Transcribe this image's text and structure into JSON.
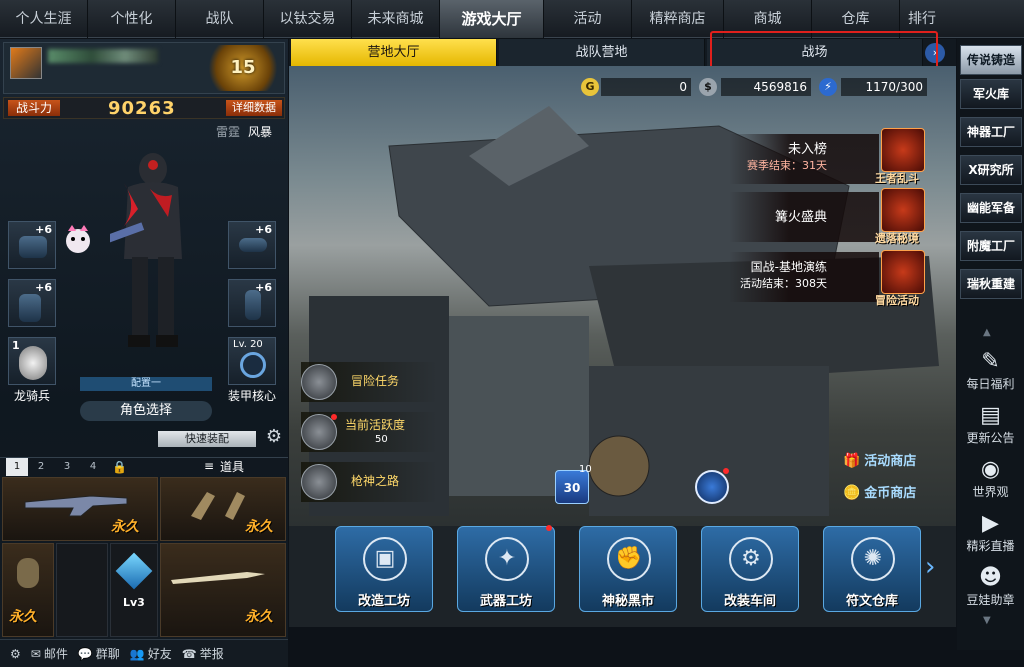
{
  "top_nav": [
    "个人生涯",
    "个性化",
    "战队",
    "以钛交易",
    "未来商城",
    "游戏大厅",
    "活动",
    "精粹商店",
    "商城",
    "仓库",
    "排行"
  ],
  "top_nav_active": 5,
  "profile": {
    "rank_level": "15",
    "combat_power_label": "战斗力",
    "combat_power_value": "90263",
    "detail_label": "详细数据",
    "mode_a": "雷霆",
    "mode_b": "风暴",
    "equip_plus_1": "+6",
    "equip_plus_2": "+6",
    "equip_plus_3": "+6",
    "equip_plus_4": "+6",
    "mount_level": "1",
    "mount_name": "龙骑兵",
    "core_level": "Lv. 20",
    "core_name": "装甲核心",
    "config_label": "配置一",
    "role_select_label": "角色选择",
    "quick_equip_label": "快速装配"
  },
  "weapon_panel": {
    "slot_tabs": [
      "1",
      "2",
      "3",
      "4"
    ],
    "props_label": "道具",
    "forever_label": "永久",
    "item_level": "Lv3"
  },
  "bottom_bar": {
    "mail": "邮件",
    "group_chat": "群聊",
    "friends": "好友",
    "report": "举报"
  },
  "center": {
    "tabs": [
      "营地大厅",
      "战队营地",
      "战场"
    ],
    "active_tab": 0,
    "currency_a": "0",
    "currency_b": "4569816",
    "energy": "1170/300",
    "events": [
      {
        "title": "未入榜",
        "sub": "赛季结束：31天",
        "icon_label": "王者乱斗"
      },
      {
        "title": "篝火盛典",
        "sub": "",
        "icon_label": "遗落秘境"
      },
      {
        "title": "国战-基地演练",
        "sub": "活动结束：308天",
        "icon_label": "冒险活动"
      }
    ],
    "missions": [
      {
        "label": "冒险任务",
        "sub": ""
      },
      {
        "label": "当前活跃度",
        "sub": "50"
      },
      {
        "label": "枪神之路",
        "sub": ""
      }
    ],
    "sign_in_badge": "10",
    "sign_in_day": "30",
    "activity_shop": "活动商店",
    "gold_shop": "金币商店",
    "workshops": [
      "改造工坊",
      "武器工坊",
      "神秘黑市",
      "改装车间",
      "符文仓库"
    ]
  },
  "right_panel": {
    "buttons": [
      "传说铸造",
      "军火库",
      "神器工厂",
      "X研究所",
      "幽能军备",
      "附魔工厂",
      "瑞秋重建"
    ],
    "active_button": 0,
    "icons": [
      {
        "label": "每日福利",
        "icon": "gift-icon"
      },
      {
        "label": "更新公告",
        "icon": "notice-icon"
      },
      {
        "label": "世界观",
        "icon": "globe-icon"
      },
      {
        "label": "精彩直播",
        "icon": "camera-icon"
      },
      {
        "label": "豆娃助章",
        "icon": "mascot-icon"
      }
    ]
  },
  "colors": {
    "accent_yellow": "#ffe04d",
    "highlight_red": "#e0201c",
    "power_gold": "#ffd36a",
    "forever_orange": "#ffb02a",
    "work_blue": "#2e6ca6"
  }
}
